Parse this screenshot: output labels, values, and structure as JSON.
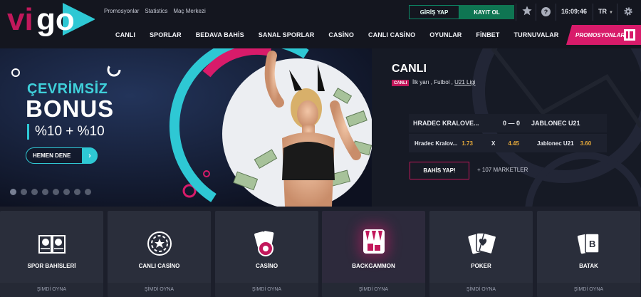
{
  "header": {
    "logo_text": "vigo",
    "top_links": [
      "Promosyonlar",
      "Statistics",
      "Maç Merkezi"
    ],
    "login_label": "GİRİŞ YAP",
    "register_label": "KAYIT OL",
    "time": "16:09:46",
    "language": "TR",
    "icons": [
      "star-icon",
      "help-icon",
      "chevron-down-icon",
      "gear-icon"
    ],
    "nav": [
      "CANLI",
      "SPORLAR",
      "BEDAVA BAHİS",
      "SANAL SPORLAR",
      "CASİNO",
      "CANLI CASİNO",
      "OYUNLAR",
      "FİNBET",
      "TURNUVALAR"
    ],
    "promo_tab": "PROMOSYONLAR",
    "colors": {
      "accent_green": "#0f7552",
      "accent_pink": "#d81b6a",
      "accent_cyan": "#2ec8d4"
    }
  },
  "banner": {
    "line1": "ÇEVRİMSİZ",
    "line2": "BONUS",
    "line3": "%10 + %10",
    "button": "HEMEN DENE",
    "slide_count": 8,
    "active_slide": 0
  },
  "live": {
    "title": "CANLI",
    "badge": "CANLI",
    "sub_prefix": "İlk yarı , Futbol , ",
    "league": "U21 Ligi",
    "home_team": "HRADEC KRALOVE...",
    "score": "0 — 0",
    "away_team": "JABLONEC U21",
    "odds": [
      {
        "name": "Hradec Kralov...",
        "value": "1.73"
      },
      {
        "name": "X",
        "value": "4.45"
      },
      {
        "name": "Jablonec U21",
        "value": "3.60"
      }
    ],
    "bet_button": "BAHİS YAP!",
    "markets": "+ 107 MARKETLER"
  },
  "tiles": [
    {
      "label": "SPOR BAHİSLERİ",
      "cta": "ŞİMDİ OYNA",
      "icon": "sports-book-icon"
    },
    {
      "label": "CANLI CASİNO",
      "cta": "ŞİMDİ OYNA",
      "icon": "live-casino-chip-icon"
    },
    {
      "label": "CASİNO",
      "cta": "ŞİMDİ OYNA",
      "icon": "casino-cards-chip-icon"
    },
    {
      "label": "BACKGAMMON",
      "cta": "ŞİMDİ OYNA",
      "icon": "backgammon-icon"
    },
    {
      "label": "POKER",
      "cta": "ŞİMDİ OYNA",
      "icon": "poker-cards-icon"
    },
    {
      "label": "BATAK",
      "cta": "ŞİMDİ OYNA",
      "icon": "batak-cards-icon"
    }
  ]
}
